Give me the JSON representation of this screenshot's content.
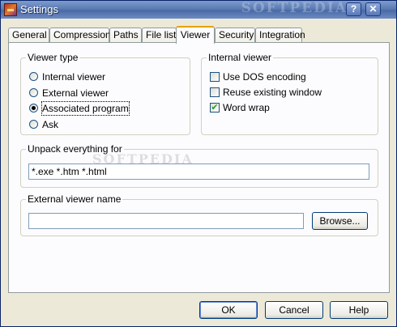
{
  "window": {
    "title": "Settings",
    "watermark": "SOFTPEDIA",
    "help_glyph": "?",
    "close_glyph": "✕"
  },
  "tabs": [
    {
      "label": "General"
    },
    {
      "label": "Compression"
    },
    {
      "label": "Paths"
    },
    {
      "label": "File list"
    },
    {
      "label": "Viewer",
      "active": true
    },
    {
      "label": "Security"
    },
    {
      "label": "Integration"
    }
  ],
  "viewer_type": {
    "label": "Viewer type",
    "options": [
      {
        "label": "Internal viewer",
        "selected": false
      },
      {
        "label": "External viewer",
        "selected": false
      },
      {
        "label": "Associated program",
        "selected": true
      },
      {
        "label": "Ask",
        "selected": false
      }
    ]
  },
  "internal_viewer": {
    "label": "Internal viewer",
    "options": [
      {
        "label": "Use DOS encoding",
        "checked": false
      },
      {
        "label": "Reuse existing window",
        "checked": false
      },
      {
        "label": "Word wrap",
        "checked": true
      }
    ]
  },
  "unpack": {
    "label": "Unpack everything for",
    "value": "*.exe *.htm *.html",
    "watermark": "SOFTPEDIA"
  },
  "external_viewer": {
    "label": "External viewer name",
    "value": "",
    "browse_label": "Browse..."
  },
  "footer": {
    "ok_label": "OK",
    "cancel_label": "Cancel",
    "help_label": "Help"
  }
}
